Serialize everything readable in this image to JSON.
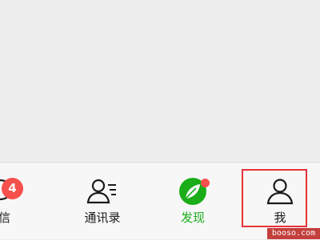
{
  "tabbar": {
    "tabs": [
      {
        "id": "chats",
        "label": "信",
        "icon": "chat-bubble-icon",
        "badge": "4"
      },
      {
        "id": "contacts",
        "label": "通讯录",
        "icon": "contacts-icon"
      },
      {
        "id": "discover",
        "label": "发现",
        "icon": "compass-icon",
        "badge_dot": true,
        "active": true
      },
      {
        "id": "me",
        "label": "我",
        "icon": "person-icon",
        "highlighted": true
      }
    ]
  },
  "colors": {
    "active": "#1aad19",
    "badge": "#f5504c",
    "highlight": "#e8323a",
    "text": "#1a1a1a"
  },
  "watermark": "booso.com"
}
